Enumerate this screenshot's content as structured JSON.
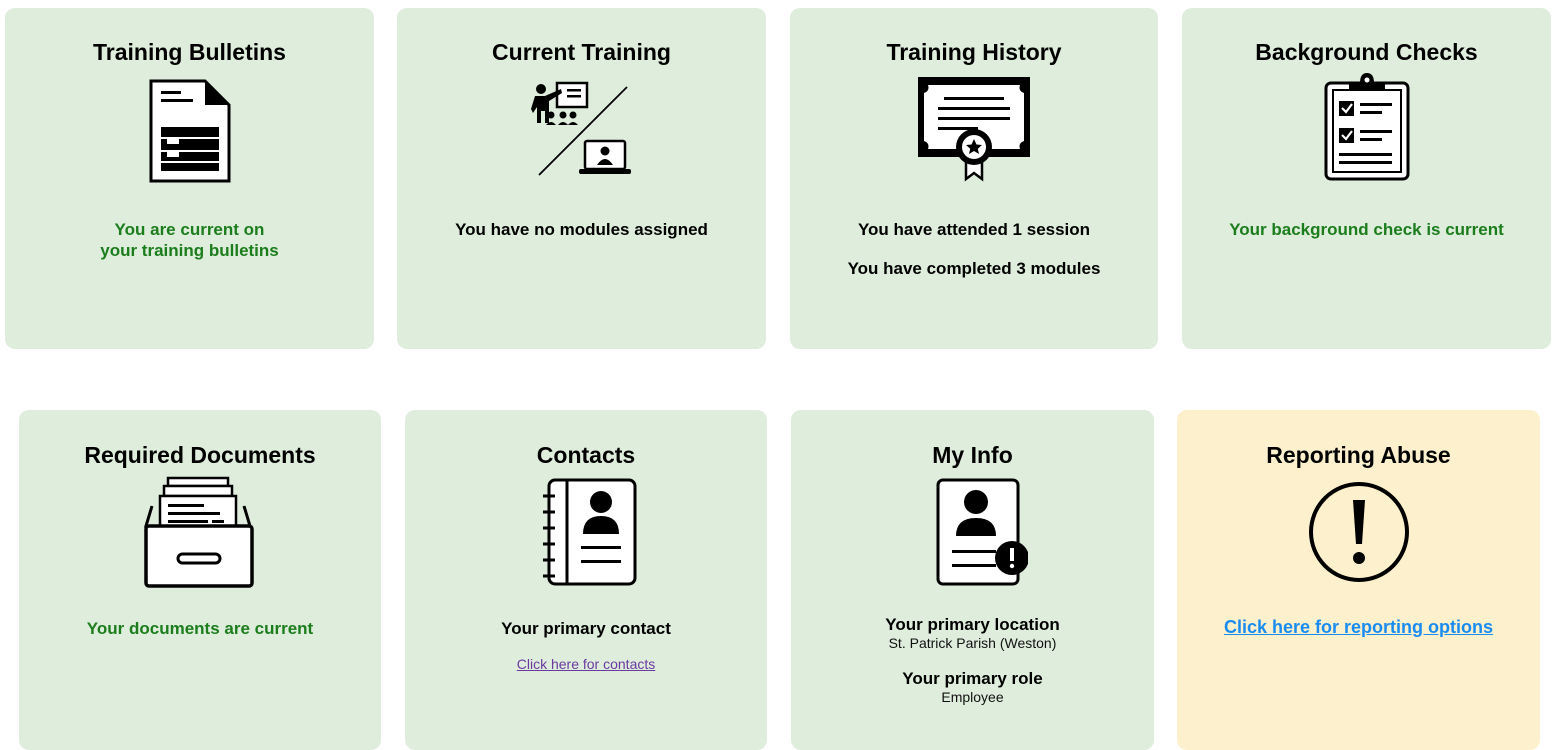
{
  "cards": {
    "training_bulletins": {
      "title": "Training Bulletins",
      "status_line1": "You are current on",
      "status_line2": "your training bulletins"
    },
    "current_training": {
      "title": "Current Training",
      "status": "You have no modules assigned"
    },
    "training_history": {
      "title": "Training History",
      "attended": "You have attended 1 session",
      "completed": "You have completed 3 modules"
    },
    "background_checks": {
      "title": "Background Checks",
      "status": "Your background check is current"
    },
    "required_documents": {
      "title": "Required Documents",
      "status": "Your documents are current"
    },
    "contacts": {
      "title": "Contacts",
      "primary_label": "Your primary contact",
      "link": "Click here for contacts"
    },
    "my_info": {
      "title": "My Info",
      "location_label": "Your primary location",
      "location_value": "St. Patrick Parish (Weston)",
      "role_label": "Your primary role",
      "role_value": "Employee"
    },
    "reporting_abuse": {
      "title": "Reporting Abuse",
      "link": "Click here for reporting options"
    }
  },
  "colors": {
    "card_green": "#deeddc",
    "card_yellow": "#fdf0cc",
    "status_green": "#1b7d1b",
    "link_blue": "#1a8cf0",
    "link_purple": "#6b3aa0"
  }
}
